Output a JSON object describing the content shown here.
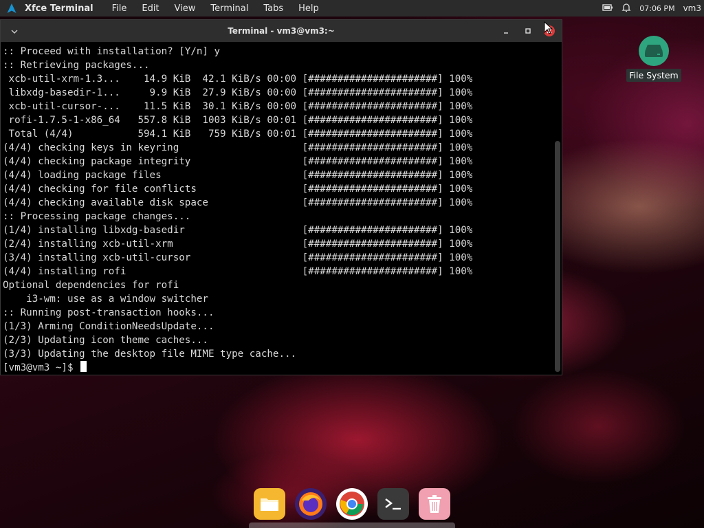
{
  "top_panel": {
    "app_name": "Xfce Terminal",
    "menu": [
      "File",
      "Edit",
      "View",
      "Terminal",
      "Tabs",
      "Help"
    ],
    "clock": "07:06 PM",
    "user": "vm3"
  },
  "window": {
    "title": "Terminal - vm3@vm3:~"
  },
  "terminal": {
    "lines": [
      ":: Proceed with installation? [Y/n] y",
      ":: Retrieving packages...",
      " xcb-util-xrm-1.3...    14.9 KiB  42.1 KiB/s 00:00 [######################] 100%",
      " libxdg-basedir-1...     9.9 KiB  27.9 KiB/s 00:00 [######################] 100%",
      " xcb-util-cursor-...    11.5 KiB  30.1 KiB/s 00:00 [######################] 100%",
      " rofi-1.7.5-1-x86_64   557.8 KiB  1003 KiB/s 00:01 [######################] 100%",
      " Total (4/4)           594.1 KiB   759 KiB/s 00:01 [######################] 100%",
      "(4/4) checking keys in keyring                     [######################] 100%",
      "(4/4) checking package integrity                   [######################] 100%",
      "(4/4) loading package files                        [######################] 100%",
      "(4/4) checking for file conflicts                  [######################] 100%",
      "(4/4) checking available disk space                [######################] 100%",
      ":: Processing package changes...",
      "(1/4) installing libxdg-basedir                    [######################] 100%",
      "(2/4) installing xcb-util-xrm                      [######################] 100%",
      "(3/4) installing xcb-util-cursor                   [######################] 100%",
      "(4/4) installing rofi                              [######################] 100%",
      "Optional dependencies for rofi",
      "    i3-wm: use as a window switcher",
      ":: Running post-transaction hooks...",
      "(1/3) Arming ConditionNeedsUpdate...",
      "(2/3) Updating icon theme caches...",
      "(3/3) Updating the desktop file MIME type cache..."
    ],
    "prompt": "[vm3@vm3 ~]$ "
  },
  "desktop": {
    "icon_label": "File System"
  },
  "dock": {
    "items": [
      "files-icon",
      "firefox-icon",
      "chrome-icon",
      "terminal-icon",
      "trash-icon"
    ]
  },
  "colors": {
    "panel_bg": "#2b2b2b",
    "terminal_bg": "#000000",
    "terminal_fg": "#d8d8d8",
    "close_button": "#d93b3b",
    "fs_icon": "#2ea57f"
  }
}
